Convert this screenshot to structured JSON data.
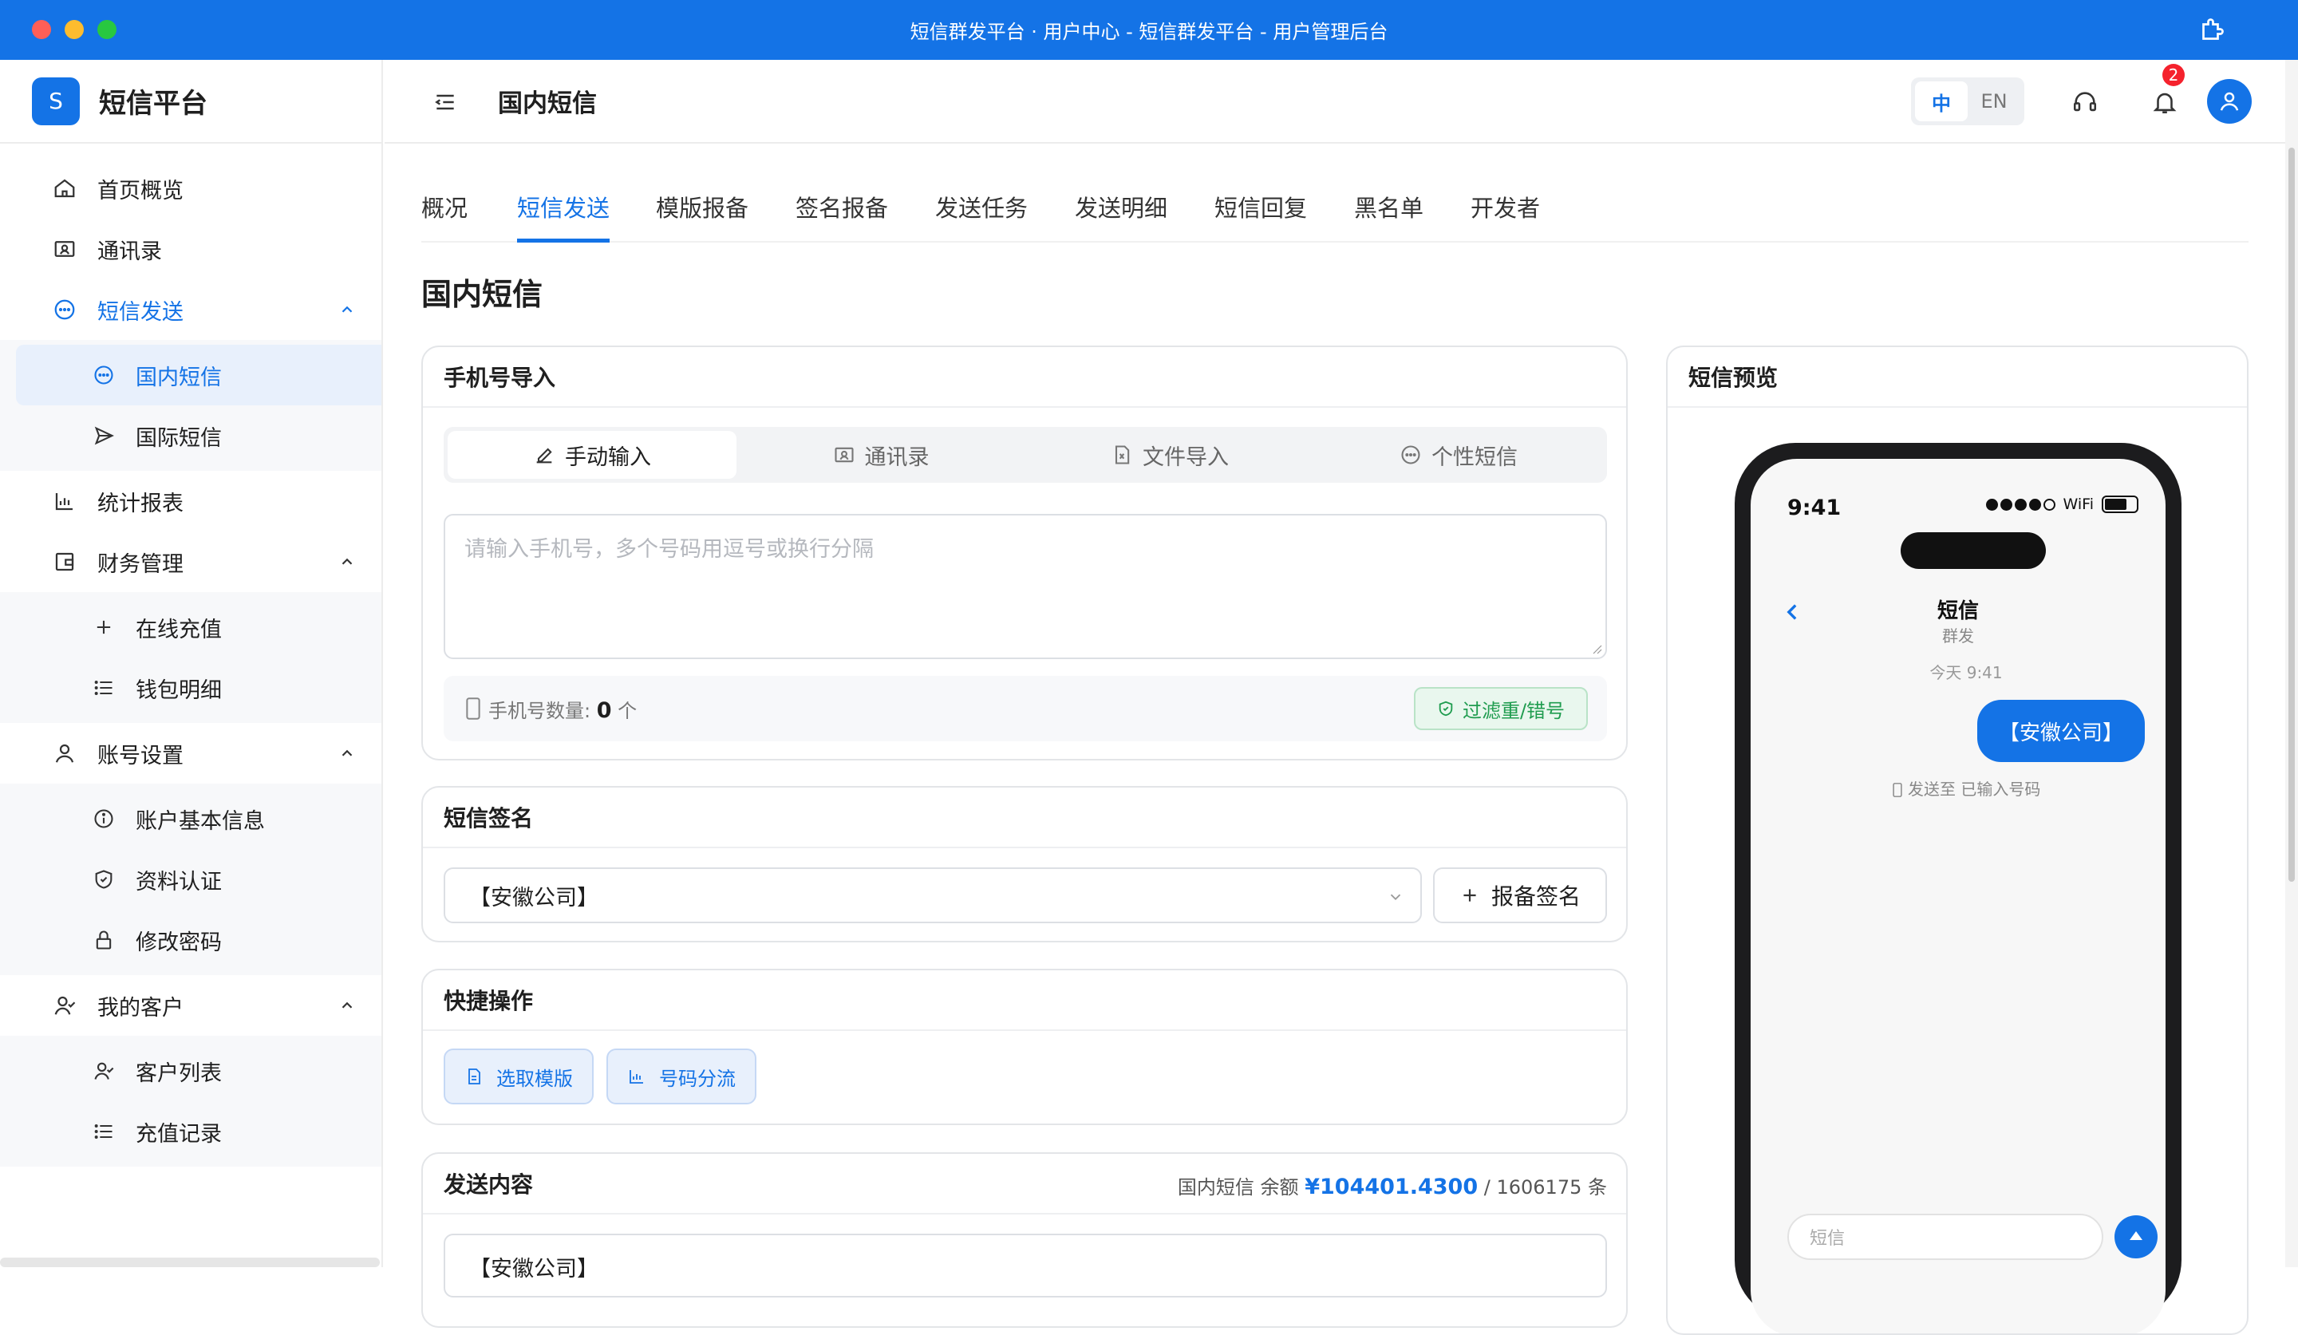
{
  "window": {
    "title": "短信群发平台 · 用户中心 - 短信群发平台 - 用户管理后台"
  },
  "brand": {
    "logo_letter": "S",
    "name": "短信平台"
  },
  "sidebar": {
    "home": "首页概览",
    "contacts": "通讯录",
    "sms_send": "短信发送",
    "domestic": "国内短信",
    "intl": "国际短信",
    "stats": "统计报表",
    "finance": "财务管理",
    "recharge": "在线充值",
    "wallet": "钱包明细",
    "account": "账号设置",
    "basic_info": "账户基本信息",
    "verify": "资料认证",
    "password": "修改密码",
    "customers": "我的客户",
    "customer_list": "客户列表",
    "recharge_records": "充值记录"
  },
  "header": {
    "title": "国内短信",
    "lang_zh": "中",
    "lang_en": "EN",
    "notification_count": "2"
  },
  "tabs": [
    "概况",
    "短信发送",
    "模版报备",
    "签名报备",
    "发送任务",
    "发送明细",
    "短信回复",
    "黑名单",
    "开发者"
  ],
  "page_title": "国内短信",
  "phone_import": {
    "title": "手机号导入",
    "modes": [
      "手动输入",
      "通讯录",
      "文件导入",
      "个性短信"
    ],
    "placeholder": "请输入手机号，多个号码用逗号或换行分隔",
    "count_label": "手机号数量:",
    "count_value": "0",
    "count_unit": "个",
    "filter_button": "过滤重/错号"
  },
  "signature": {
    "title": "短信签名",
    "selected": "【安徽公司】",
    "report_button": "报备签名"
  },
  "quick_ops": {
    "title": "快捷操作",
    "select_template": "选取模版",
    "number_split": "号码分流"
  },
  "send_content": {
    "title": "发送内容",
    "balance_prefix": "国内短信 余额",
    "balance_amount": "¥104401.4300",
    "balance_suffix": "/ 1606175 条",
    "text": "【安徽公司】"
  },
  "preview": {
    "title": "短信预览",
    "time": "9:41",
    "wifi": "WiFi",
    "chat_title": "短信",
    "chat_sub": "群发",
    "chat_time": "今天 9:41",
    "bubble": "【安徽公司】",
    "sent_to": "发送至 已输入号码",
    "compose_placeholder": "短信"
  },
  "colors": {
    "accent": "#1473e6",
    "success": "#1f9c4f",
    "badge": "#f5222d"
  }
}
